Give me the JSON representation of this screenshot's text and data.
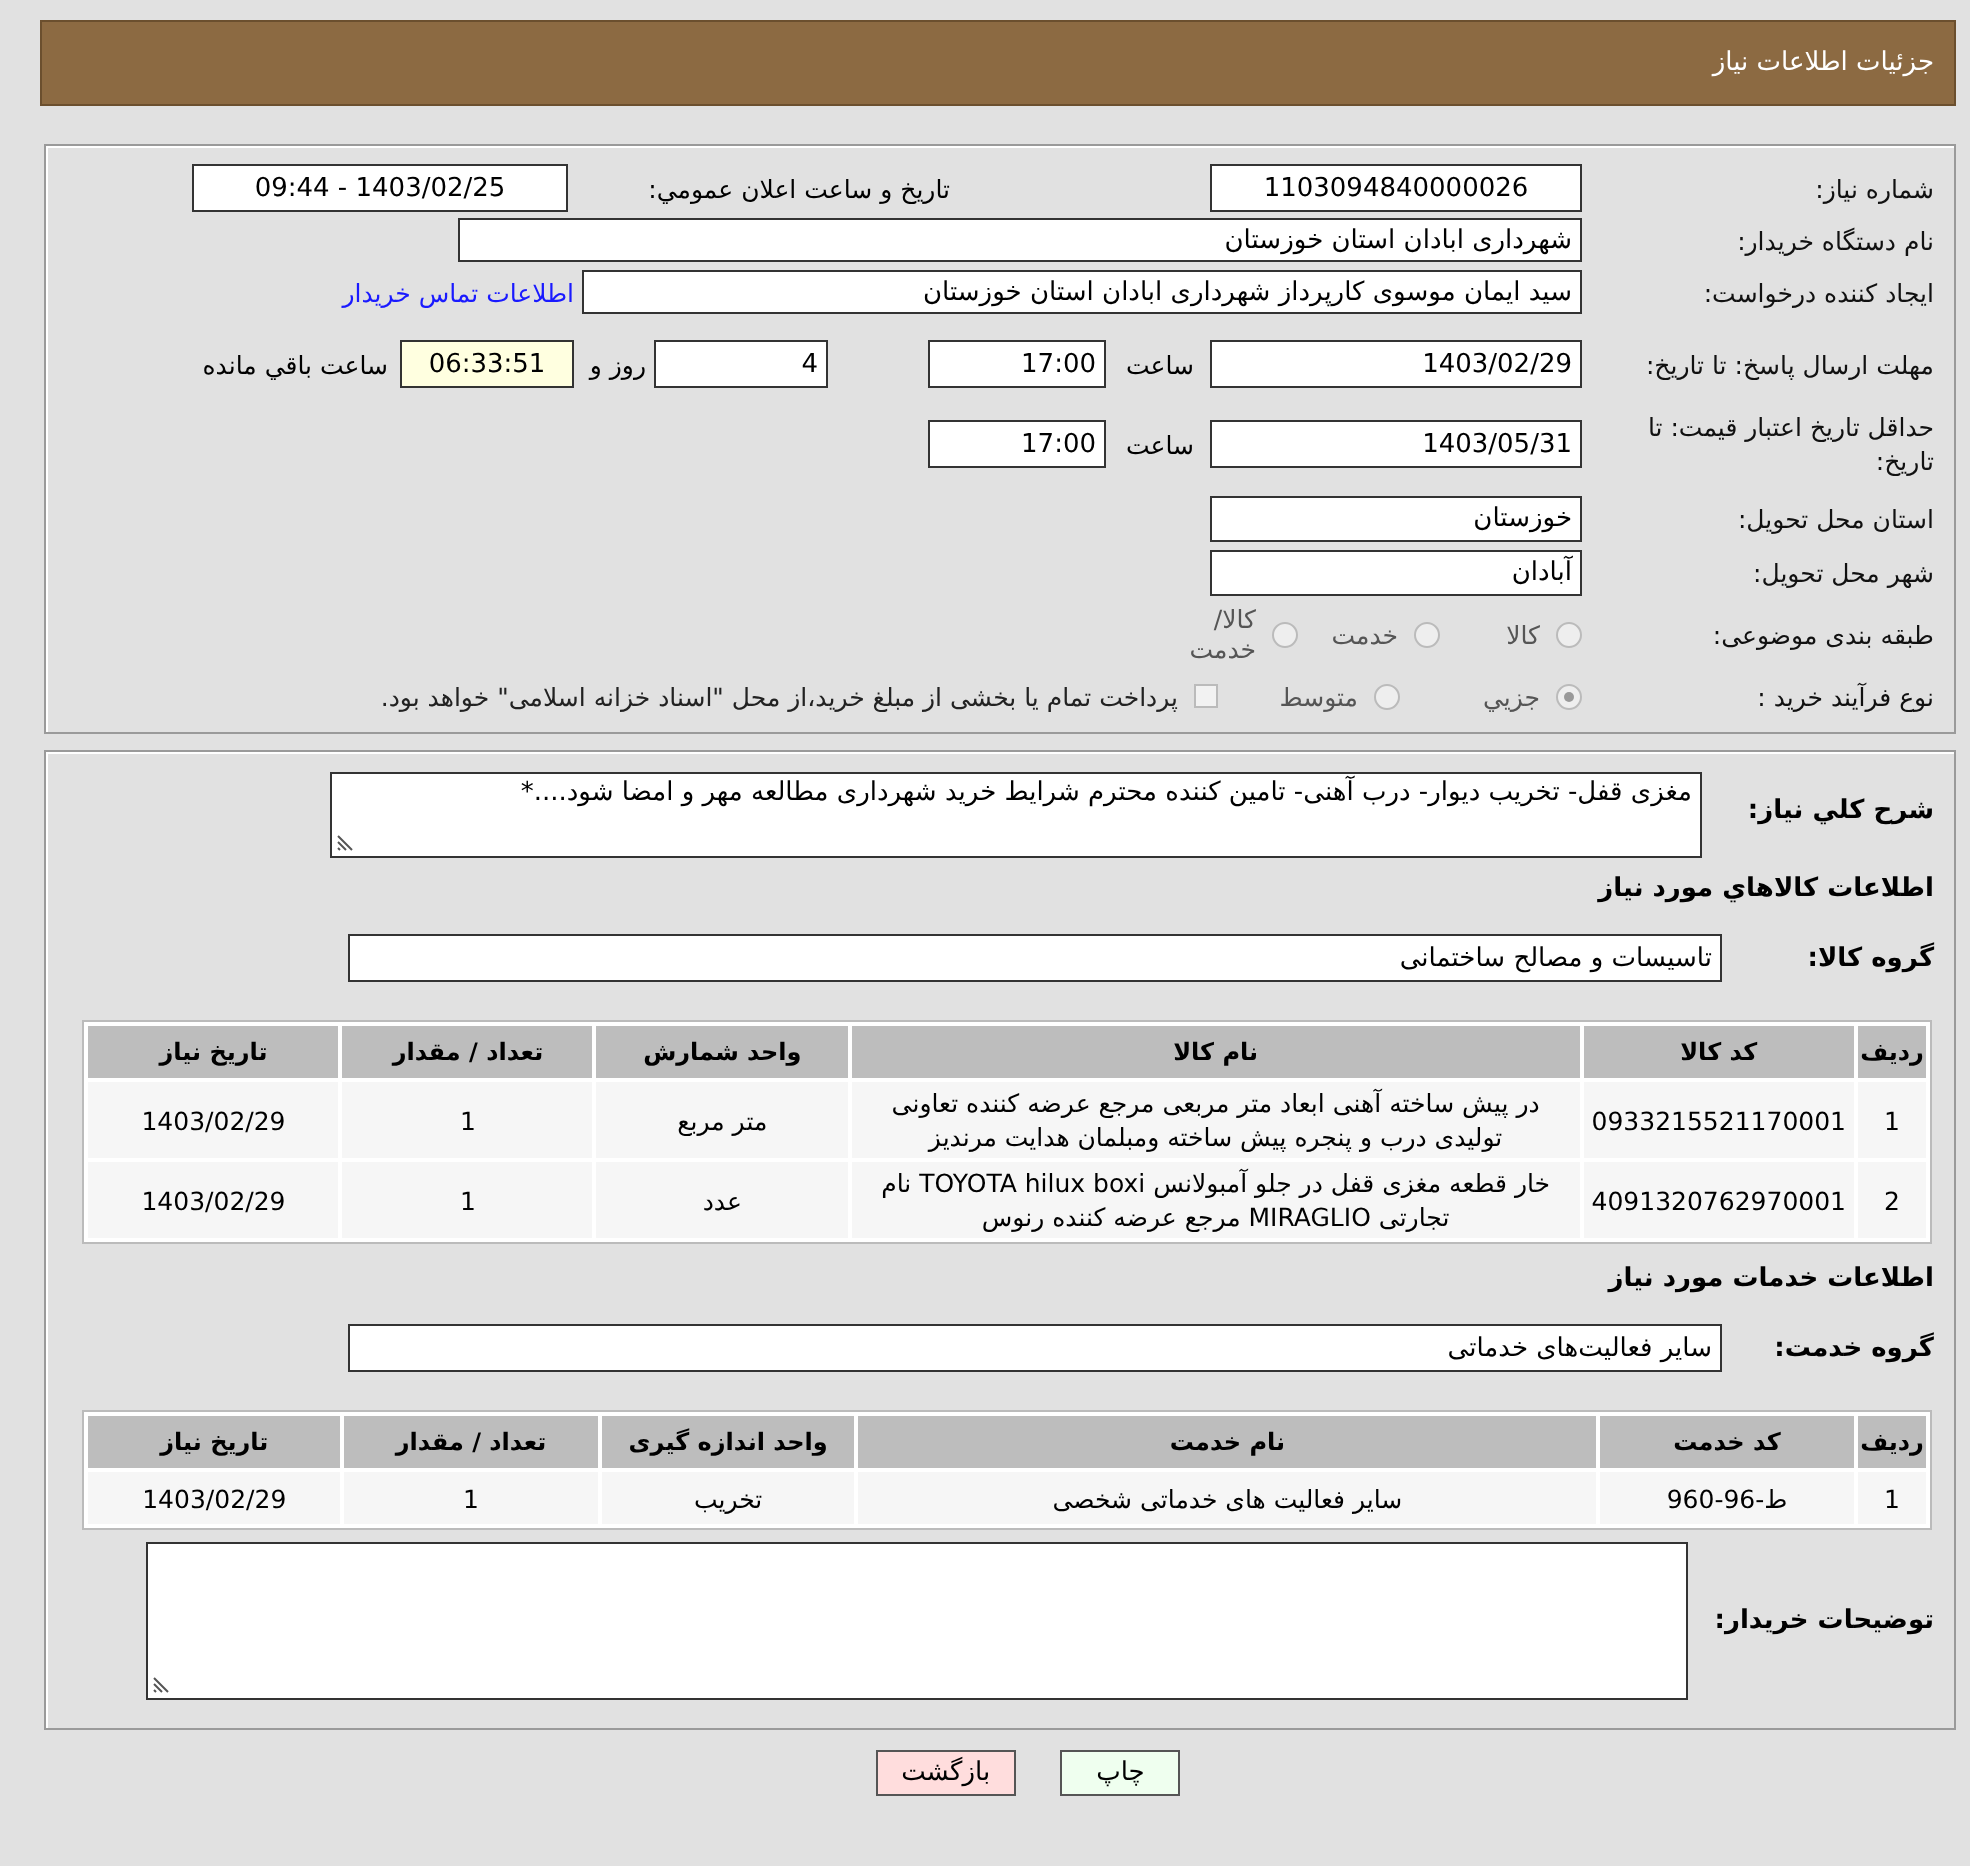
{
  "header": {
    "title": "جزئیات اطلاعات نیاز"
  },
  "details": {
    "need_number": {
      "label": "شماره نیاز:",
      "value": "1103094840000026"
    },
    "announce": {
      "label": "تاریخ و ساعت اعلان عمومي:",
      "value": "1403/02/25 - 09:44"
    },
    "buyer_org": {
      "label": "نام دستگاه خریدار:",
      "value": "شهرداری ابادان استان خوزستان"
    },
    "requester": {
      "label": "ایجاد کننده درخواست:",
      "value": "سید ایمان موسوی کارپرداز شهرداری ابادان استان خوزستان",
      "link": "اطلاعات تماس خریدار"
    },
    "reply_deadline": {
      "label": "مهلت ارسال پاسخ: تا تاریخ:",
      "date": "1403/02/29",
      "time_label": "ساعت",
      "time": "17:00",
      "days": "4",
      "days_label": "روز و",
      "remaining": "06:33:51",
      "remaining_label": "ساعت باقي مانده"
    },
    "price_validity": {
      "label": "حداقل تاریخ اعتبار قیمت: تا تاریخ:",
      "date": "1403/05/31",
      "time_label": "ساعت",
      "time": "17:00"
    },
    "province": {
      "label": "استان محل تحویل:",
      "value": "خوزستان"
    },
    "city": {
      "label": "شهر محل تحویل:",
      "value": "آبادان"
    },
    "category": {
      "label": "طبقه بندی موضوعی:",
      "options": [
        {
          "label": "کالا",
          "selected": false
        },
        {
          "label": "خدمت",
          "selected": false
        },
        {
          "label": "کالا/خدمت",
          "selected": false
        }
      ]
    },
    "purchase_type": {
      "label": "نوع فرآیند خرید :",
      "options": [
        {
          "label": "جزيي",
          "selected": true
        },
        {
          "label": "متوسط",
          "selected": false
        }
      ],
      "payment_note": {
        "checked": false,
        "text": "پرداخت تمام یا بخشی از مبلغ خرید،از محل \"اسناد خزانه اسلامی\" خواهد بود."
      }
    }
  },
  "description": {
    "label": "شرح کلي نیاز:",
    "value": "مغزی قفل- تخریب دیوار- درب آهنی- تامین کننده محترم شرایط خرید شهرداری مطالعه مهر و امضا شود....*"
  },
  "goods": {
    "heading": "اطلاعات کالاهاي مورد نیاز",
    "group_label": "گروه کالا:",
    "group": "تاسیسات و مصالح ساختمانی",
    "table": {
      "columns": [
        "ردیف",
        "کد کالا",
        "نام کالا",
        "واحد شمارش",
        "تعداد / مقدار",
        "تاریخ نیاز"
      ],
      "rows": [
        [
          "1",
          "0933215521170001",
          "در پیش ساخته آهنی ابعاد متر مربعی مرجع عرضه کننده تعاونی تولیدی درب و پنجره پیش ساخته ومبلمان هدایت مرندیز",
          "متر مربع",
          "1",
          "1403/02/29"
        ],
        [
          "2",
          "4091320762970001",
          "خار قطعه مغزی قفل در جلو آمبولانس TOYOTA hilux boxi نام تجارتی MIRAGLIO مرجع عرضه کننده رنوس",
          "عدد",
          "1",
          "1403/02/29"
        ]
      ]
    }
  },
  "services": {
    "heading": "اطلاعات خدمات مورد نیاز",
    "group_label": "گروه خدمت:",
    "group": "سایر فعالیت‌های خدماتی",
    "table": {
      "columns": [
        "ردیف",
        "کد خدمت",
        "نام خدمت",
        "واحد اندازه گیری",
        "تعداد / مقدار",
        "تاریخ نیاز"
      ],
      "rows": [
        [
          "1",
          "ط-96-960",
          "سایر فعالیت های خدماتی شخصی",
          "تخریب",
          "1",
          "1403/02/29"
        ]
      ]
    }
  },
  "buyer_notes": {
    "label": "توضیحات خریدار:"
  },
  "buttons": [
    {
      "label": "چاپ",
      "kind": "print"
    },
    {
      "label": "بازگشت",
      "kind": "back"
    }
  ]
}
